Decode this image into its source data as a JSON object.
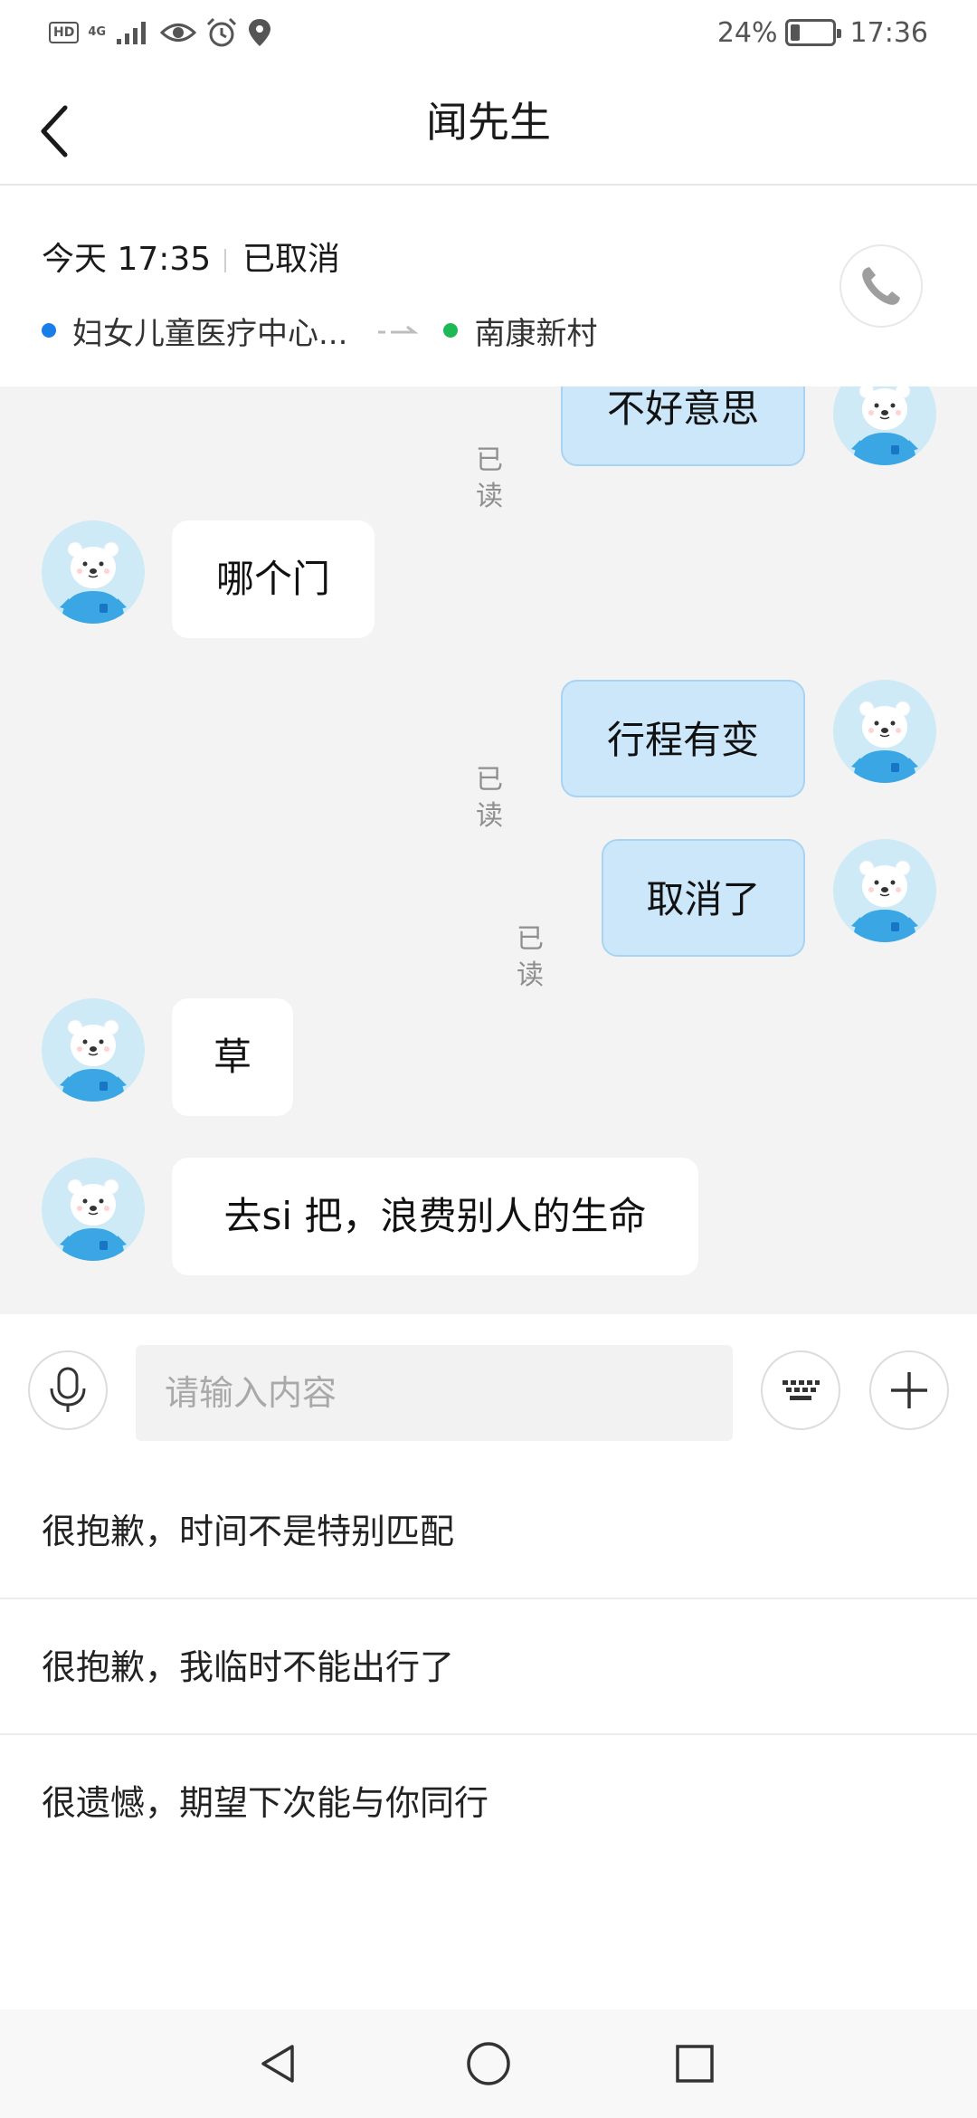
{
  "status_bar": {
    "hd": "HD",
    "network": "4G",
    "battery_percent": "24%",
    "battery_level": 0.24,
    "time": "17:36",
    "icons": [
      "signal-icon",
      "eye-icon",
      "alarm-icon",
      "location-icon"
    ]
  },
  "header": {
    "title": "闻先生",
    "back_icon": "chevron-left-icon"
  },
  "trip": {
    "time": "今天 17:35",
    "status": "已取消",
    "origin": "妇女儿童医疗中心...",
    "destination": "南康新村",
    "origin_color": "#1a7ee8",
    "destination_color": "#1db954",
    "phone_icon": "phone-icon"
  },
  "messages": [
    {
      "direction": "out",
      "text": "不好意思",
      "read": "已读"
    },
    {
      "direction": "in",
      "text": "哪个门"
    },
    {
      "direction": "out",
      "text": "行程有变",
      "read": "已读"
    },
    {
      "direction": "out",
      "text": "取消了",
      "read": "已读"
    },
    {
      "direction": "in",
      "text": "草"
    },
    {
      "direction": "in",
      "text": "去si 把，浪费别人的生命"
    }
  ],
  "input_bar": {
    "placeholder": "请输入内容",
    "voice_icon": "microphone-icon",
    "keyboard_icon": "keyboard-icon",
    "add_icon": "plus-icon"
  },
  "quick_replies": [
    "很抱歉，时间不是特别匹配",
    "很抱歉，我临时不能出行了",
    "很遗憾，期望下次能与你同行"
  ],
  "colors": {
    "bubble_out": "#cce7fa",
    "bubble_in": "#ffffff",
    "chat_background": "#f3f3f3"
  },
  "nav_bar": {
    "back_icon": "triangle-back-icon",
    "home_icon": "circle-home-icon",
    "recents_icon": "square-recents-icon"
  }
}
